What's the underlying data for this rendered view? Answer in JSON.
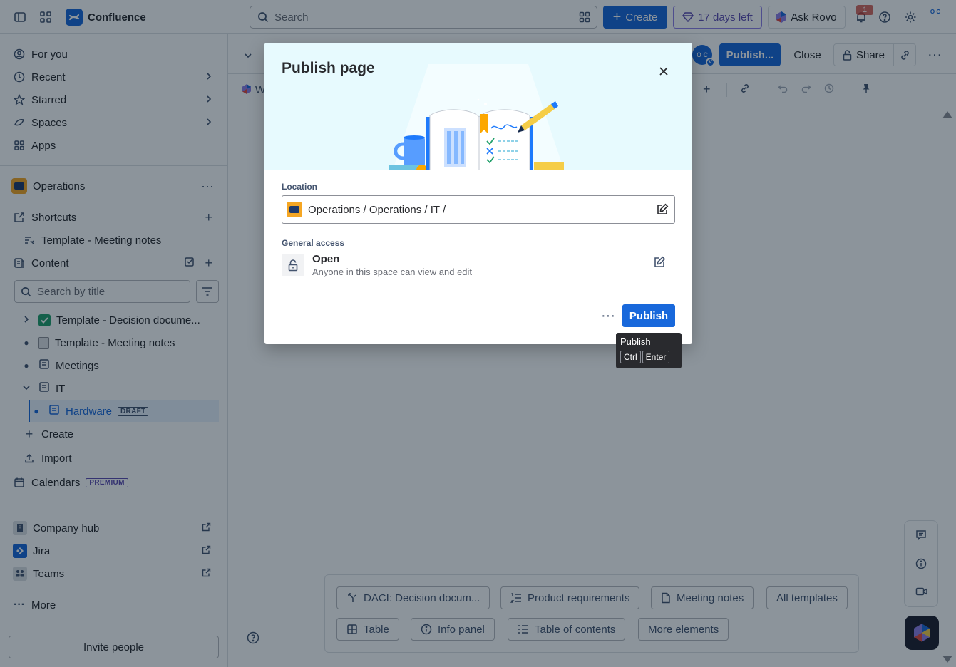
{
  "topnav": {
    "app_name": "Confluence",
    "search_placeholder": "Search",
    "create_label": "Create",
    "trial_label": "17 days left",
    "rovo_label": "Ask Rovo",
    "notification_count": "1",
    "avatar_initials": "O C"
  },
  "sidebar": {
    "primary": [
      {
        "label": "For you",
        "icon": "person-circle-icon"
      },
      {
        "label": "Recent",
        "icon": "clock-icon"
      },
      {
        "label": "Starred",
        "icon": "star-icon"
      },
      {
        "label": "Spaces",
        "icon": "spaces-icon"
      },
      {
        "label": "Apps",
        "icon": "apps-icon"
      }
    ],
    "space_name": "Operations",
    "shortcuts_label": "Shortcuts",
    "shortcut_item": "Template - Meeting notes",
    "content_label": "Content",
    "tree_search_placeholder": "Search by title",
    "tree": [
      {
        "label": "Template - Decision docume..."
      },
      {
        "label": "Template - Meeting notes"
      },
      {
        "label": "Meetings"
      },
      {
        "label": "IT"
      },
      {
        "label": "Hardware",
        "lozenge": "DRAFT"
      }
    ],
    "create_label": "Create",
    "import_label": "Import",
    "calendars_label": "Calendars",
    "calendars_lozenge": "PREMIUM",
    "apps": [
      {
        "label": "Company hub"
      },
      {
        "label": "Jira"
      },
      {
        "label": "Teams"
      }
    ],
    "more_label": "More",
    "invite_label": "Invite people"
  },
  "editor": {
    "avatar_initials": "O C",
    "avatar_badge": "V",
    "publish_label": "Publish...",
    "close_label": "Close",
    "share_label": "Share",
    "breadcrumb_partial": "W"
  },
  "templates": {
    "row1": [
      "DACI: Decision docum...",
      "Product requirements",
      "Meeting notes",
      "All templates"
    ],
    "row2": [
      "Table",
      "Info panel",
      "Table of contents",
      "More elements"
    ]
  },
  "modal": {
    "title": "Publish page",
    "location_label": "Location",
    "location_path": "Operations / Operations / IT /",
    "access_label": "General access",
    "access_title": "Open",
    "access_subtitle": "Anyone in this space can view and edit",
    "publish_label": "Publish"
  },
  "tooltip": {
    "title": "Publish",
    "key1": "Ctrl",
    "key2": "Enter"
  },
  "colors": {
    "brand_blue": "#1868db",
    "trial_purple": "#5e4db2",
    "hero_bg": "#e7fafe",
    "overlay": "rgba(5,21,36,0.46)"
  }
}
